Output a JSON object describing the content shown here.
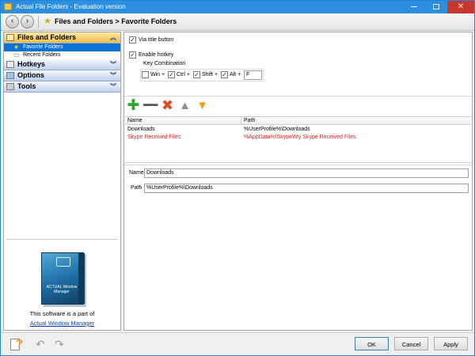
{
  "window": {
    "title": "Actual File Folders - Evaluation version"
  },
  "breadcrumb": {
    "text": "Files and Folders > Favorite Folders"
  },
  "sidebar": {
    "sections": [
      {
        "label": "Files and Folders",
        "items": [
          "Favorite Folders",
          "Recent Folders"
        ]
      },
      {
        "label": "Hotkeys"
      },
      {
        "label": "Options"
      },
      {
        "label": "Tools"
      }
    ],
    "promo": {
      "product_lettering": "ACTUAL Window Manager",
      "text": "This software is a part of",
      "link": "Actual Window Manager"
    }
  },
  "settings": {
    "via_title_button": {
      "label": "Via title button",
      "checked": true
    },
    "enable_hotkey": {
      "label": "Enable hotkey",
      "checked": true
    },
    "key_combination": {
      "title": "Key Combination",
      "win": {
        "label": "Win +",
        "checked": false
      },
      "ctrl": {
        "label": "Ctrl +",
        "checked": true
      },
      "shift": {
        "label": "Shift +",
        "checked": true
      },
      "alt": {
        "label": "Alt +",
        "checked": true
      },
      "key": "F"
    }
  },
  "list": {
    "columns": [
      "Name",
      "Path"
    ],
    "rows": [
      {
        "name": "Downloads",
        "path": "%UserProfile%\\Downloads"
      },
      {
        "name": "Skype Received Files",
        "path": "%AppData%\\Skype\\My Skype Received Files"
      }
    ]
  },
  "details": {
    "name_label": "Name",
    "name_value": "Downloads",
    "path_label": "Path",
    "path_value": "%UserProfile%\\Downloads"
  },
  "buttons": {
    "ok": "OK",
    "cancel": "Cancel",
    "apply": "Apply"
  },
  "colors": {
    "title_bar": "#2b8ee0",
    "selection": "#0a72d8",
    "missing_entry": "#e02020"
  }
}
